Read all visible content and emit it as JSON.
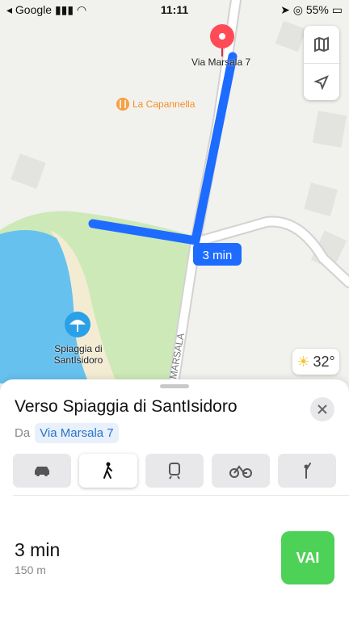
{
  "status": {
    "carrier": "Google",
    "time": "11:11",
    "battery": "55%"
  },
  "map": {
    "poi_restaurant": "La Capannella",
    "destination_pin_label": "Via Marsala 7",
    "beach_label": "Spiaggia di SantIsidoro",
    "road_label": "MARSALA",
    "eta_bubble": "3 min",
    "weather": "32°",
    "icons": [
      "map-icon",
      "location-arrow-icon",
      "fork-knife-icon",
      "beach-umbrella-icon",
      "sun-icon"
    ]
  },
  "sheet": {
    "title": "Verso Spiaggia di SantIsidoro",
    "from_label": "Da",
    "from_value": "Via Marsala 7",
    "modes": [
      "car",
      "walk",
      "train",
      "bike",
      "rideshare"
    ],
    "selected_mode": "walk",
    "eta": "3 min",
    "distance": "150 m",
    "go": "VAI"
  },
  "colors": {
    "route": "#1e6cff",
    "water": "#67c1ef",
    "park": "#cde9b8",
    "go": "#4ed157"
  }
}
